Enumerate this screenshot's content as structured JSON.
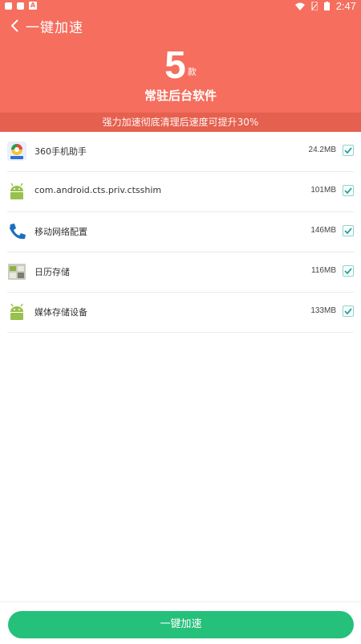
{
  "status_bar": {
    "time": "2:47"
  },
  "header": {
    "title": "一键加速",
    "count": "5",
    "count_unit": "款",
    "subtitle": "常驻后台软件",
    "banner": "强力加速彻底清理后速度可提升30%"
  },
  "apps": [
    {
      "name": "360手机助手",
      "size": "24.2MB",
      "icon": "360-assistant-icon",
      "checked": true
    },
    {
      "name": "com.android.cts.priv.ctsshim",
      "size": "101MB",
      "icon": "android-icon",
      "checked": true
    },
    {
      "name": "移动网络配置",
      "size": "146MB",
      "icon": "phone-icon",
      "checked": true
    },
    {
      "name": "日历存储",
      "size": "116MB",
      "icon": "calendar-storage-icon",
      "checked": true
    },
    {
      "name": "媒体存储设备",
      "size": "133MB",
      "icon": "android-icon",
      "checked": true
    }
  ],
  "footer": {
    "button_label": "一键加速"
  },
  "colors": {
    "header": "#f56e5e",
    "banner": "#e5604f",
    "button": "#25c07a",
    "check": "#19a89a"
  }
}
